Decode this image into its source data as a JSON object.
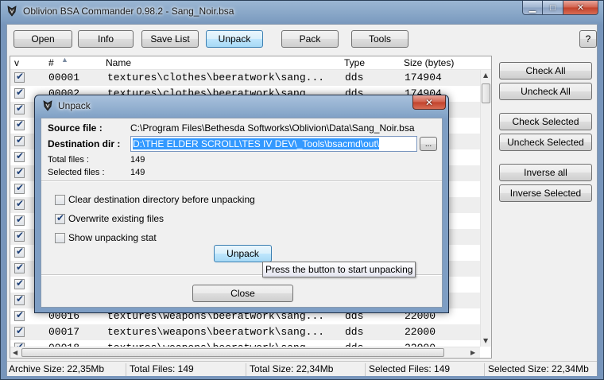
{
  "window": {
    "title": "Oblivion BSA Commander 0.98.2 - Sang_Noir.bsa",
    "min_glyph": "▁",
    "max_glyph": "□",
    "close_glyph": "✕"
  },
  "toolbar": {
    "open": "Open",
    "info": "Info",
    "save_list": "Save List",
    "unpack": "Unpack",
    "pack": "Pack",
    "tools": "Tools",
    "help": "?"
  },
  "side_buttons": {
    "check_all": "Check All",
    "uncheck_all": "Uncheck All",
    "check_selected": "Check Selected",
    "uncheck_selected": "Uncheck Selected",
    "inverse_all": "Inverse all",
    "inverse_selected": "Inverse Selected"
  },
  "list": {
    "columns": {
      "v": "v",
      "num": "#",
      "name": "Name",
      "type": "Type",
      "size": "Size (bytes)"
    },
    "rows": [
      {
        "checked": true,
        "num": "00001",
        "name": "textures\\clothes\\beeratwork\\sang...",
        "type": "dds",
        "size": "174904"
      },
      {
        "checked": true,
        "num": "00002",
        "name": "textures\\clothes\\beeratwork\\sang...",
        "type": "dds",
        "size": "174904"
      },
      {
        "checked": true,
        "num": "",
        "name": "",
        "type": "",
        "size": ""
      },
      {
        "checked": true,
        "num": "",
        "name": "",
        "type": "",
        "size": ""
      },
      {
        "checked": true,
        "num": "",
        "name": "",
        "type": "",
        "size": ""
      },
      {
        "checked": true,
        "num": "",
        "name": "",
        "type": "",
        "size": ""
      },
      {
        "checked": true,
        "num": "",
        "name": "",
        "type": "",
        "size": ""
      },
      {
        "checked": true,
        "num": "",
        "name": "",
        "type": "",
        "size": ""
      },
      {
        "checked": true,
        "num": "",
        "name": "",
        "type": "",
        "size": ""
      },
      {
        "checked": true,
        "num": "",
        "name": "",
        "type": "",
        "size": ""
      },
      {
        "checked": true,
        "num": "",
        "name": "",
        "type": "",
        "size": ""
      },
      {
        "checked": true,
        "num": "",
        "name": "",
        "type": "",
        "size": ""
      },
      {
        "checked": true,
        "num": "",
        "name": "",
        "type": "",
        "size": ""
      },
      {
        "checked": true,
        "num": "",
        "name": "",
        "type": "",
        "size": ""
      },
      {
        "checked": true,
        "num": "",
        "name": "",
        "type": "",
        "size": ""
      },
      {
        "checked": true,
        "num": "00016",
        "name": "textures\\weapons\\beeratwork\\sang...",
        "type": "dds",
        "size": "22000"
      },
      {
        "checked": true,
        "num": "00017",
        "name": "textures\\weapons\\beeratwork\\sang...",
        "type": "dds",
        "size": "22000"
      },
      {
        "checked": true,
        "num": "00018",
        "name": "textures\\weapons\\beeratwork\\sang...",
        "type": "dds",
        "size": "22000"
      }
    ]
  },
  "statusbar": {
    "archive_size": "Archive Size: 22,35Mb",
    "total_files": "Total Files: 149",
    "total_size": "Total Size: 22,34Mb",
    "selected_files": "Selected Files: 149",
    "selected_size": "Selected Size: 22,34Mb"
  },
  "dialog": {
    "title": "Unpack",
    "source_label": "Source file :",
    "source_value": "C:\\Program Files\\Bethesda Softworks\\Oblivion\\Data\\Sang_Noir.bsa",
    "dest_label": "Destination dir :",
    "dest_value": "D:\\THE ELDER SCROLL\\TES IV DEV\\_Tools\\bsacmd\\out\\",
    "browse": "...",
    "total_files_label": "Total files :",
    "total_files_value": "149",
    "selected_files_label": "Selected files :",
    "selected_files_value": "149",
    "opt_clear": {
      "label": "Clear destination directory before unpacking",
      "checked": false
    },
    "opt_overwrite": {
      "label": "Overwrite existing files",
      "checked": true
    },
    "opt_stat": {
      "label": "Show unpacking stat",
      "checked": false
    },
    "unpack_button": "Unpack",
    "tooltip": "Press the button to start unpacking",
    "close_button": "Close",
    "close_glyph": "✕"
  },
  "icons": {
    "app": "bsa-commander-icon",
    "sort": "sort-ascending-icon",
    "check": "✔"
  },
  "colors": {
    "selection": "#3399ff",
    "title_frame": "#86a6c9",
    "close_red": "#c2412a",
    "active_button": "#bee6fd"
  }
}
